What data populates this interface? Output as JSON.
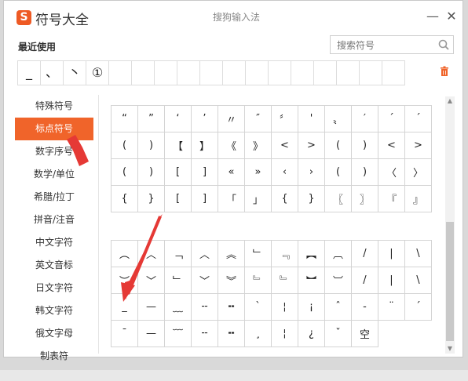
{
  "window": {
    "title": "符号大全",
    "ime_name": "搜狗输入法",
    "logo_glyph": "S",
    "minimize_glyph": "—",
    "close_glyph": "✕"
  },
  "recent": {
    "label": "最近使用",
    "items": [
      "_",
      "、",
      "丶",
      "①",
      "",
      "",
      "",
      "",
      "",
      "",
      "",
      "",
      "",
      "",
      "",
      "",
      ""
    ]
  },
  "search": {
    "placeholder": "搜索符号"
  },
  "sidebar": {
    "items": [
      "特殊符号",
      "标点符号",
      "数字序号",
      "数学/单位",
      "希腊/拉丁",
      "拼音/注音",
      "中文字符",
      "英文音标",
      "日文字符",
      "韩文字符",
      "俄文字母",
      "制表符"
    ],
    "active_index": 1
  },
  "grid_top": [
    [
      "“",
      "”",
      "‘",
      "’",
      "〃",
      "″",
      "〞",
      "'",
      "〟",
      "′",
      "´",
      "ˊ"
    ],
    [
      "(",
      ")",
      "【",
      "】",
      "《",
      "》",
      "<",
      ">",
      "(",
      ")",
      "<",
      ">"
    ],
    [
      "(",
      ")",
      "[",
      "]",
      "«",
      "»",
      "‹",
      "›",
      "(",
      ")",
      "〈",
      "〉"
    ],
    [
      "{",
      "}",
      "[",
      "]",
      "「",
      "」",
      "{",
      "}",
      "〖",
      "〗",
      "『",
      "』"
    ]
  ],
  "grid_bottom": [
    [
      "︵",
      "︿",
      "﹁",
      "︿",
      "︽",
      "﹂",
      "﹃",
      "︻",
      "︹",
      "/",
      "|",
      "\\"
    ],
    [
      "︶",
      "﹀",
      "﹂",
      "﹀",
      "︾",
      "﹄",
      "﹄",
      "︼",
      "︺",
      "/",
      "|",
      "\\"
    ],
    [
      "_",
      "—",
      "﹏",
      "╌",
      "╍",
      "ˋ",
      "¦",
      "¡",
      "ˆ",
      "-",
      "¨",
      "ˊ"
    ],
    [
      "¯",
      "—",
      "﹋",
      "╌",
      "╍",
      "¸",
      "¦",
      "¿",
      "ˇ",
      "空"
    ]
  ],
  "colors": {
    "accent": "#f0642a",
    "arrow": "#e53935",
    "logo": "#ee5a24"
  },
  "icons": {
    "search": "search-icon",
    "trash": "trash-icon",
    "close": "close-icon",
    "minimize": "minimize-icon"
  }
}
